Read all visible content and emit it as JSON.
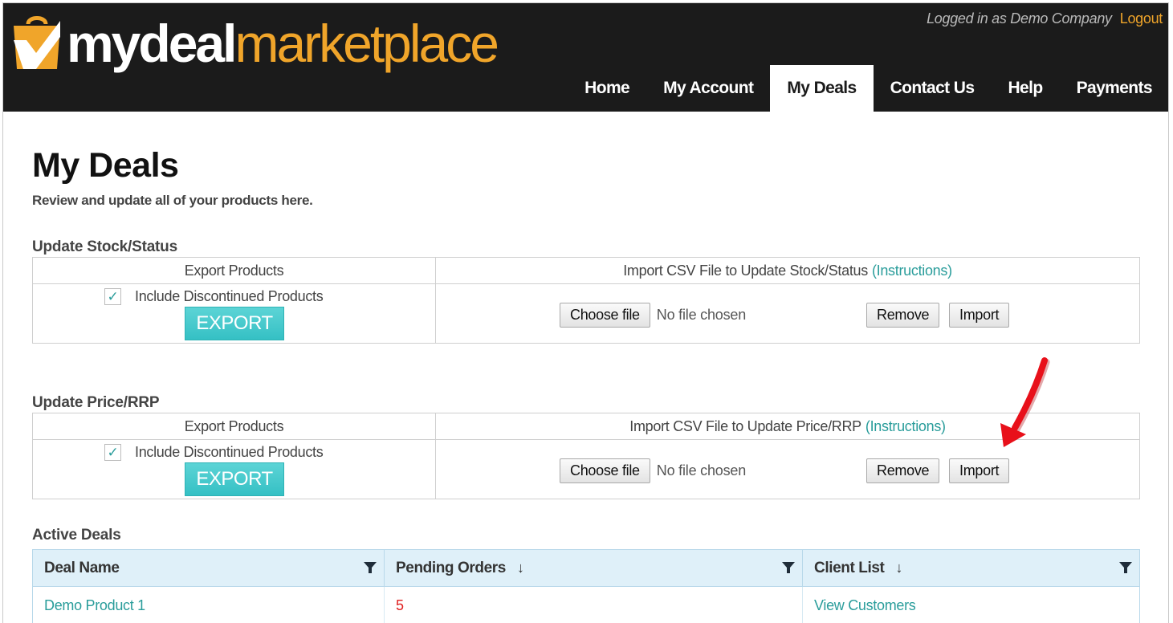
{
  "header": {
    "logo": {
      "part1": "my",
      "part2": "deal",
      "part3": "marketplace"
    },
    "login_text": "Logged in as Demo Company",
    "logout_label": "Logout",
    "nav": [
      {
        "label": "Home",
        "active": false
      },
      {
        "label": "My Account",
        "active": false
      },
      {
        "label": "My Deals",
        "active": true
      },
      {
        "label": "Contact Us",
        "active": false
      },
      {
        "label": "Help",
        "active": false
      },
      {
        "label": "Payments",
        "active": false
      }
    ]
  },
  "page": {
    "title": "My Deals",
    "subtitle": "Review and update all of your products here."
  },
  "stock_section": {
    "title": "Update Stock/Status",
    "export_header": "Export Products",
    "import_header": "Import CSV File to Update Stock/Status",
    "instructions_link": "(Instructions)",
    "checkbox_label": "Include Discontinued Products",
    "checkbox_checked": true,
    "export_button": "EXPORT",
    "choose_file_button": "Choose file",
    "no_file_text": "No file chosen",
    "remove_button": "Remove",
    "import_button": "Import"
  },
  "price_section": {
    "title": "Update Price/RRP",
    "export_header": "Export Products",
    "import_header": "Import CSV File to Update Price/RRP",
    "instructions_link": "(Instructions)",
    "checkbox_label": "Include Discontinued Products",
    "checkbox_checked": true,
    "export_button": "EXPORT",
    "choose_file_button": "Choose file",
    "no_file_text": "No file chosen",
    "remove_button": "Remove",
    "import_button": "Import"
  },
  "active_deals": {
    "title": "Active Deals",
    "columns": [
      {
        "label": "Deal Name",
        "sort_icon": ""
      },
      {
        "label": "Pending Orders",
        "sort_icon": "↓"
      },
      {
        "label": "Client List",
        "sort_icon": "↓"
      }
    ],
    "rows": [
      {
        "deal_name": "Demo Product 1",
        "pending_orders": "5",
        "client_list": "View Customers"
      }
    ]
  },
  "colors": {
    "header_bg": "#1b1b1b",
    "brand_orange": "#f0a52a",
    "teal_accent": "#2a9d9b",
    "export_button": "#3fc5c8",
    "grid_header_bg": "#dff0f9",
    "annotation_arrow": "#e8101a"
  },
  "icons": {
    "logo": "shopping-bag-check-icon",
    "checkbox": "checkmark-icon",
    "column_filter": "filter-funnel-icon",
    "annotation": "red-arrow-icon"
  }
}
